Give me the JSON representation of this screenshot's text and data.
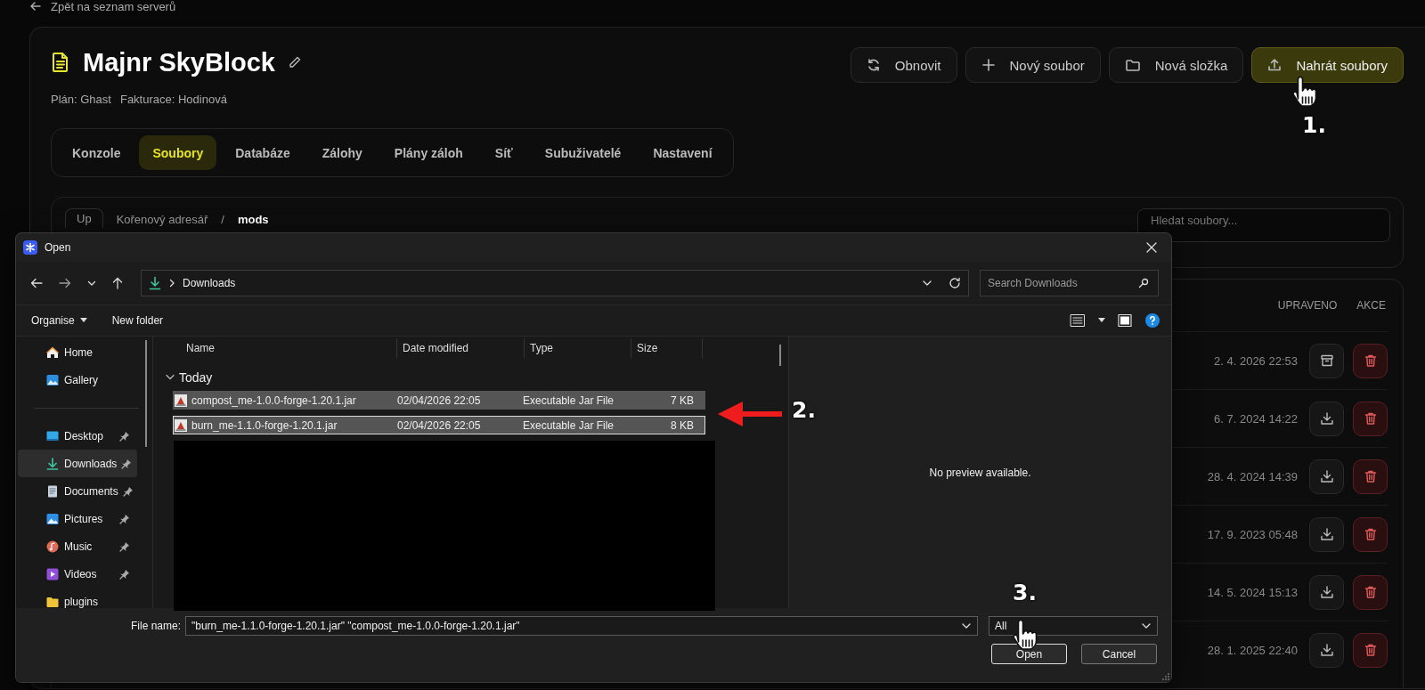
{
  "back_link": "Zpět na seznam serverů",
  "server": {
    "title": "Majnr SkyBlock",
    "plan": "Plán: Ghast",
    "billing": "Fakturace: Hodinová"
  },
  "actions": [
    {
      "label": "Obnovit",
      "kind": "refresh",
      "primary": false
    },
    {
      "label": "Nový soubor",
      "kind": "new-file",
      "primary": false
    },
    {
      "label": "Nová složka",
      "kind": "new-folder",
      "primary": false
    },
    {
      "label": "Nahrát soubory",
      "kind": "upload",
      "primary": true
    }
  ],
  "tabs": [
    {
      "label": "Konzole",
      "selected": false
    },
    {
      "label": "Soubory",
      "selected": true
    },
    {
      "label": "Databáze",
      "selected": false
    },
    {
      "label": "Zálohy",
      "selected": false
    },
    {
      "label": "Plány záloh",
      "selected": false
    },
    {
      "label": "Síť",
      "selected": false
    },
    {
      "label": "Subuživatelé",
      "selected": false
    },
    {
      "label": "Nastavení",
      "selected": false
    }
  ],
  "breadcrumb": {
    "up": "Up",
    "root": "Kořenový adresář",
    "separator": "/",
    "current": "mods"
  },
  "file_search": {
    "placeholder": "Hledat soubory..."
  },
  "file_table": {
    "columns": [
      "UPRAVENO",
      "AKCE"
    ],
    "rows": [
      {
        "modified": "2. 4. 2026 22:53",
        "kind": "folder"
      },
      {
        "modified": "6. 7. 2024 14:22",
        "kind": "file"
      },
      {
        "modified": "28. 4. 2024 14:39",
        "kind": "file"
      },
      {
        "modified": "17. 9. 2023 05:48",
        "kind": "file"
      },
      {
        "modified": "14. 5. 2024 15:13",
        "kind": "file"
      },
      {
        "modified": "28. 1. 2025 22:40",
        "kind": "file"
      }
    ]
  },
  "dialog": {
    "title": "Open",
    "path": "Downloads",
    "search_placeholder": "Search Downloads",
    "toolbar": [
      "Organise",
      "New folder"
    ],
    "nav_items": [
      {
        "label": "Home",
        "kind": "home",
        "pinned": false,
        "selected": false
      },
      {
        "label": "Gallery",
        "kind": "gallery",
        "pinned": false,
        "selected": false
      },
      {
        "label": "Desktop",
        "kind": "desktop",
        "pinned": true,
        "selected": false
      },
      {
        "label": "Downloads",
        "kind": "downloads",
        "pinned": true,
        "selected": true
      },
      {
        "label": "Documents",
        "kind": "documents",
        "pinned": true,
        "selected": false
      },
      {
        "label": "Pictures",
        "kind": "pictures",
        "pinned": true,
        "selected": false
      },
      {
        "label": "Music",
        "kind": "music",
        "pinned": true,
        "selected": false
      },
      {
        "label": "Videos",
        "kind": "videos",
        "pinned": true,
        "selected": false
      },
      {
        "label": "plugins",
        "kind": "folder",
        "pinned": false,
        "selected": false
      }
    ],
    "columns": [
      "Name",
      "Date modified",
      "Type",
      "Size"
    ],
    "group": "Today",
    "files": [
      {
        "name": "compost_me-1.0.0-forge-1.20.1.jar",
        "date": "02/04/2026 22:05",
        "type": "Executable Jar File",
        "size": "7 KB",
        "selected": true,
        "focused": false
      },
      {
        "name": "burn_me-1.1.0-forge-1.20.1.jar",
        "date": "02/04/2026 22:05",
        "type": "Executable Jar File",
        "size": "8 KB",
        "selected": true,
        "focused": true
      }
    ],
    "preview": "No preview available.",
    "file_name_label": "File name:",
    "file_name": "\"burn_me-1.1.0-forge-1.20.1.jar\" \"compost_me-1.0.0-forge-1.20.1.jar\"",
    "file_type": "All",
    "buttons": [
      "Open",
      "Cancel"
    ]
  },
  "annotations": [
    {
      "label": "1.",
      "kind": "hand"
    },
    {
      "label": "2.",
      "kind": "arrow"
    },
    {
      "label": "3.",
      "kind": "hand"
    }
  ]
}
